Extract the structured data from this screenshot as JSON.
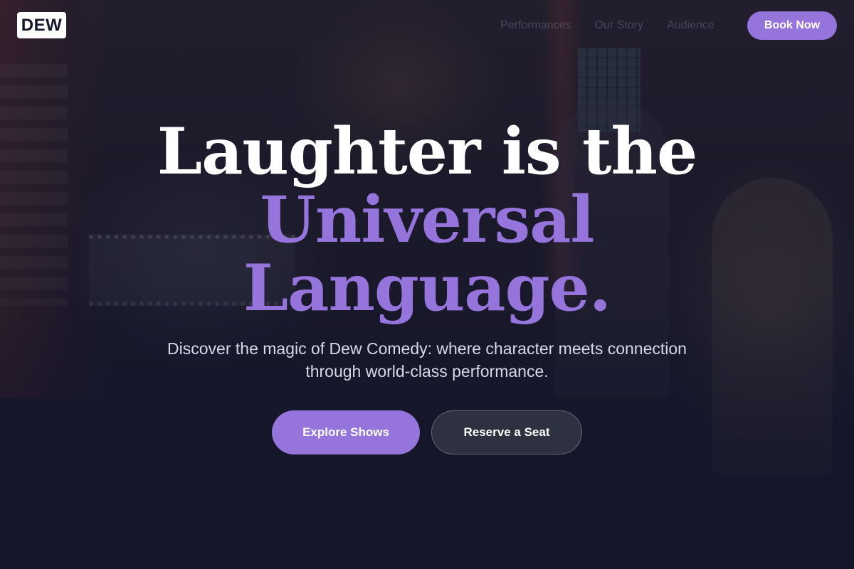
{
  "brand": {
    "logo_text": "DEW"
  },
  "nav": {
    "links": [
      {
        "label": "Performances"
      },
      {
        "label": "Our Story"
      },
      {
        "label": "Audience"
      }
    ],
    "book_label": "Book Now"
  },
  "hero": {
    "headline_line1": "Laughter is the",
    "headline_line2": "Universal",
    "headline_line3": "Language.",
    "subtitle_line1": "Discover the magic of Dew Comedy: where character meets connection",
    "subtitle_line2": "through world-class performance.",
    "primary_cta": "Explore Shows",
    "secondary_cta": "Reserve a Seat"
  },
  "colors": {
    "accent": "#9575dc",
    "background": "#141629",
    "text_primary": "#ffffff",
    "text_secondary": "#d8d9e6"
  }
}
